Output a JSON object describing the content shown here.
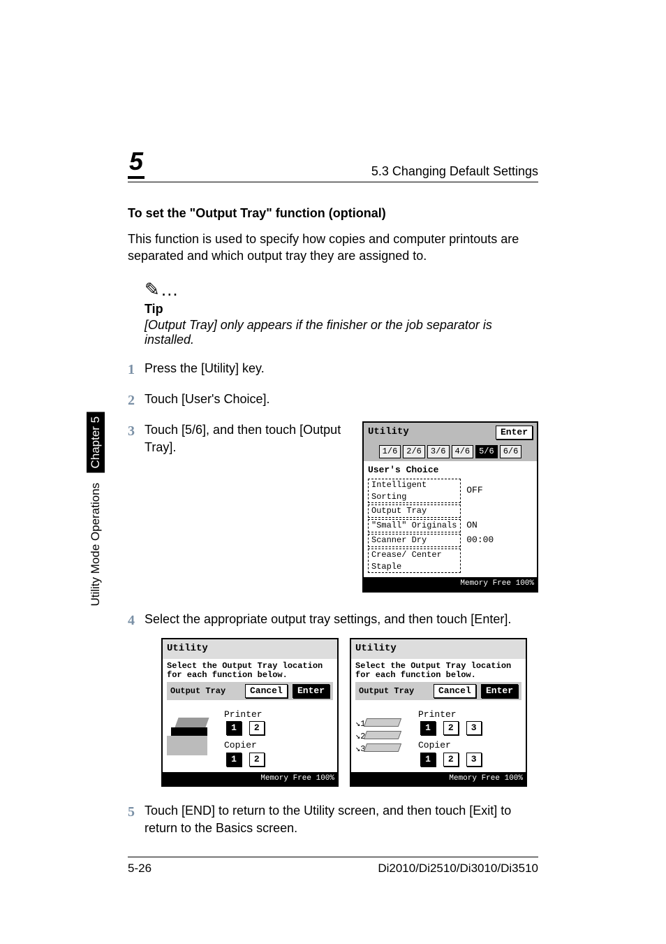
{
  "header": {
    "chapter_number": "5",
    "section_title": "5.3 Changing Default Settings"
  },
  "sidetab": {
    "text": "Utility Mode Operations",
    "chapter_label": "Chapter 5"
  },
  "heading": "To set the \"Output Tray\" function (optional)",
  "intro": "This function is used to specify how copies and computer printouts are separated and which output tray they are assigned to.",
  "tip": {
    "icon": "✎…",
    "label": "Tip",
    "text": "[Output Tray] only appears if the finisher or the job separator is installed."
  },
  "steps": {
    "s1": "Press the [Utility] key.",
    "s2": "Touch [User's Choice].",
    "s3": "Touch [5/6], and then touch [Output Tray].",
    "s4": "Select the appropriate output tray settings, and then touch [Enter].",
    "s5": "Touch [END] to return to the Utility screen, and then touch [Exit] to return to the Basics screen."
  },
  "screen1": {
    "title": "Utility",
    "enter": "Enter",
    "tabs": [
      "1/6",
      "2/6",
      "3/6",
      "4/6",
      "5/6",
      "6/6"
    ],
    "active_tab": "5/6",
    "subtitle": "User's Choice",
    "rows": [
      {
        "k": "Intelligent Sorting",
        "v": "OFF"
      },
      {
        "k": "Output Tray",
        "v": ""
      },
      {
        "k": "\"Small\" Originals",
        "v": "ON"
      },
      {
        "k": "Scanner Dry",
        "v": "00:00"
      },
      {
        "k": "Crease/ Center Staple",
        "v": ""
      }
    ],
    "memory": "Memory Free 100%"
  },
  "screen2": {
    "title": "Utility",
    "msg": "Select the Output Tray location for each function below.",
    "label": "Output Tray",
    "cancel": "Cancel",
    "enter": "Enter",
    "printer": "Printer",
    "copier": "Copier",
    "printer_sel": "1",
    "copier_sel": "1",
    "memory": "Memory Free 100%"
  },
  "screen3": {
    "title": "Utility",
    "msg": "Select the Output Tray location for each function below.",
    "label": "Output Tray",
    "cancel": "Cancel",
    "enter": "Enter",
    "printer": "Printer",
    "copier": "Copier",
    "printer_sel": "1",
    "copier_sel": "1",
    "memory": "Memory Free 100%"
  },
  "footer": {
    "page": "5-26",
    "model": "Di2010/Di2510/Di3010/Di3510"
  }
}
